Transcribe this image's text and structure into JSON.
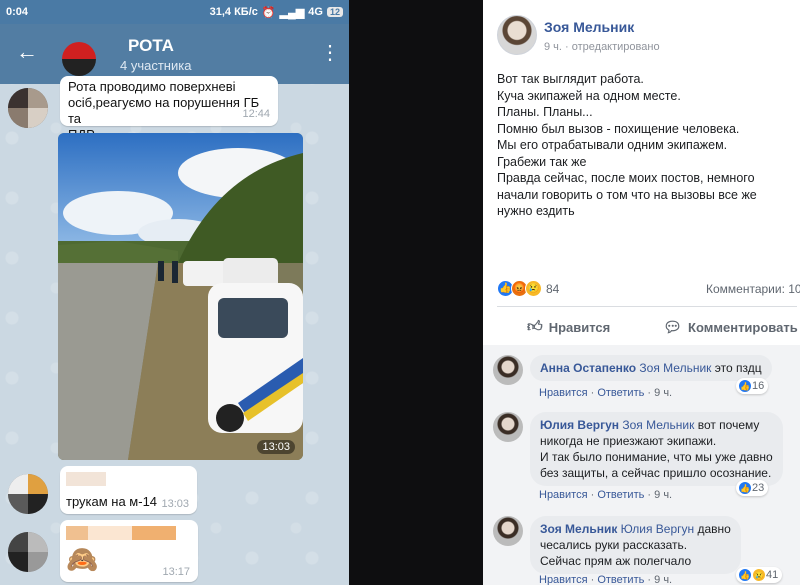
{
  "telegram": {
    "status_bar": {
      "time": "0:04",
      "speed": "31,4 КБ/с",
      "network": "4G",
      "battery": "12"
    },
    "header": {
      "title": "РОТА",
      "subtitle": "4 участника",
      "back_icon": "arrow-left-icon",
      "menu_icon": "more-vertical-icon"
    },
    "messages": [
      {
        "lines": [
          "Рота проводимо поверхневі",
          "осіб,реагуємо на порушення ГБ та",
          "ПДР."
        ],
        "time": "12:44"
      },
      {
        "type": "photo",
        "time": "13:03"
      },
      {
        "text": "трукам на м-14",
        "time": "13:03"
      },
      {
        "emoji": "🙈",
        "time": "13:17"
      }
    ]
  },
  "facebook": {
    "author": "Зоя Мельник",
    "meta": "9 ч. · отредактировано",
    "post_lines": [
      "Вот так выглядит работа.",
      "Куча экипажей на одном месте.",
      "Планы. Планы...",
      "Помню был вызов - похищение человека.",
      "Мы его отрабатывали одним экипажем.",
      "Грабежи так же",
      "Правда сейчас, после моих постов, немного",
      "начали говорить о том что на вызовы все же",
      "нужно ездить"
    ],
    "reactions_count": "84",
    "comments_count": "Комментарии: 10",
    "actions": {
      "like": "Нравится",
      "comment": "Комментировать"
    },
    "comments": [
      {
        "name": "Анна Остапенко",
        "mention": "Зоя Мельник",
        "lines": [
          "это пздц"
        ],
        "like": "Нравится",
        "reply": "Ответить",
        "time": "9 ч.",
        "reaction_count": "16"
      },
      {
        "name": "Юлия Вергун",
        "mention": "Зоя Мельник",
        "lines": [
          "вот почему",
          "никогда не приезжают экипажи.",
          "И так было понимание, что мы уже давно",
          "без защиты, а сейчас пришло осознание."
        ],
        "like": "Нравится",
        "reply": "Ответить",
        "time": "9 ч.",
        "reaction_count": "23"
      },
      {
        "name": "Зоя Мельник",
        "mention": "Юлия Вергун",
        "lines": [
          "давно",
          "чесались руки рассказать.",
          "Сейчас прям аж полегчало"
        ],
        "like": "Нравится",
        "reply": "Ответить",
        "time": "9 ч.",
        "reaction_count": "41"
      }
    ],
    "colors": {
      "link": "#385898",
      "like": "#2078f4",
      "angry": "#e9710f",
      "sad": "#f7b928"
    }
  }
}
